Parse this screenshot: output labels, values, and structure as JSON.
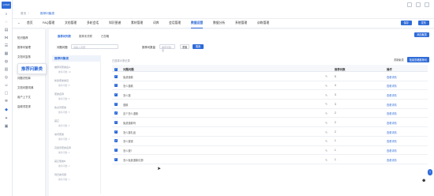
{
  "app": {
    "logo_text": "LOGO"
  },
  "topbar": {
    "breadcrumb": [
      "首页",
      "推荐问聚类"
    ],
    "home_label": "首页"
  },
  "nav": {
    "items": [
      "FAQ管理",
      "文档管理",
      "多轮会话",
      "知识图谱",
      "素材管理",
      "词库",
      "会话管理",
      "数据运营",
      "数据分析",
      "系统管理",
      "训练管理"
    ],
    "active_index": 7,
    "right_btns": [
      "保存",
      "发布"
    ]
  },
  "submenu": {
    "items": [
      "知识推荐",
      "推荐问管理",
      "文档问复核",
      "推荐问聚类",
      "问题识别库",
      "文档问题词典",
      "用户上下文",
      "高频词发现"
    ],
    "active_index": 3
  },
  "tabs": {
    "items": [
      "推荐问列表",
      "推荐未关联",
      "已忽略"
    ],
    "active_index": 0
  },
  "add_button": "添加聚类",
  "filter": {
    "label1": "问题问题",
    "placeholder1": "请输入问题",
    "label2": "推荐问数量",
    "placeholder2": "推荐问数量",
    "reset": "重置",
    "search": "搜索"
  },
  "category": {
    "head": "推荐问聚类",
    "items": [
      {
        "name": "推荐问聚类名A",
        "sub": "推荐问数: 12"
      },
      {
        "name": "新建聚类类目",
        "sub": "推荐问数: 8"
      },
      {
        "name": "聚类名称",
        "sub": "推荐问数: 6"
      },
      {
        "name": "热点问聚类",
        "sub": "推荐问数: 5"
      },
      {
        "name": "其它",
        "sub": "推荐问数: 4"
      },
      {
        "name": "常问聚类",
        "sub": "推荐问数: 3"
      },
      {
        "name": "高频问聚类名称",
        "sub": "推荐问数: 2"
      },
      {
        "name": "其它聚类B",
        "sub": "推荐问数: 2"
      },
      {
        "name": "待归类问题",
        "sub": "推荐问数: 1"
      }
    ]
  },
  "table": {
    "info": "已选择10条记录",
    "tools": [
      "重新聚类",
      "批量忽略推荐问"
    ],
    "headers": [
      "问题问题",
      "推荐问数",
      "操作"
    ],
    "rows": [
      {
        "q": "免费退款",
        "count": "5",
        "op": "查看详情"
      },
      {
        "q": "怎么退款",
        "count": "4",
        "op": "查看详情"
      },
      {
        "q": "怎么退",
        "count": "3",
        "op": "查看详情"
      },
      {
        "q": "退款",
        "count": "3",
        "op": "查看详情"
      },
      {
        "q": "这个怎么退款",
        "count": "2",
        "op": "查看详情"
      },
      {
        "q": "免费退款吗",
        "count": "2",
        "op": "查看详情"
      },
      {
        "q": "怎么退礼品",
        "count": "2",
        "op": "查看详情"
      },
      {
        "q": "怎么退钱",
        "count": "1",
        "op": "查看详情"
      },
      {
        "q": "怎么退?",
        "count": "1",
        "op": "查看详情"
      },
      {
        "q": "怎么免费退款礼物",
        "count": "1",
        "op": "查看详情"
      }
    ]
  }
}
